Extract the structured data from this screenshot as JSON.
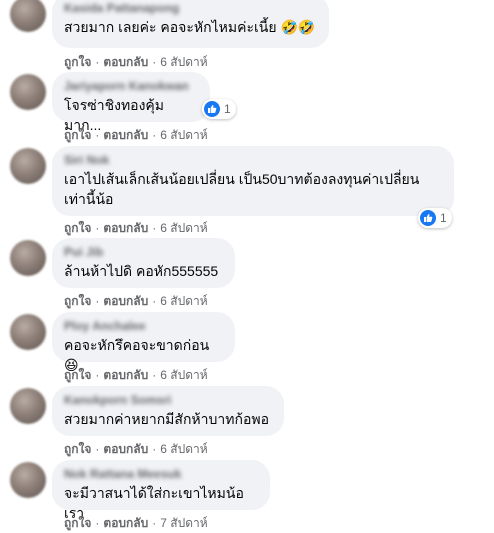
{
  "comments": [
    {
      "author": "Kasida Pattanapong",
      "text": "สวยมาก เลยค่ะ คอจะหักไหมค่ะเนี้ย 🤣🤣",
      "actions": {
        "like": "ถูกใจ",
        "reply": "ตอบกลับ",
        "time": "6 สัปดาห์"
      }
    },
    {
      "author": "Jariyaporn Kanokwan",
      "text": "โจรซ่าชิงทองคุ้มมาก...",
      "reaction_count": "1",
      "actions": {
        "like": "ถูกใจ",
        "reply": "ตอบกลับ",
        "time": "6 สัปดาห์"
      }
    },
    {
      "author": "Siri Nok",
      "text": "เอาไปเส้นเล็กเส้นน้อยเปลี่ยน เป็น50บาทต้องลงทุนค่าเปลี่ยน\nเท่านี้น้อ",
      "reaction_count": "1",
      "actions": {
        "like": "ถูกใจ",
        "reply": "ตอบกลับ",
        "time": "6 สัปดาห์"
      }
    },
    {
      "author": "Pui Jib",
      "text": "ล้านห้าไปดิ คอหัก555555",
      "actions": {
        "like": "ถูกใจ",
        "reply": "ตอบกลับ",
        "time": "6 สัปดาห์"
      }
    },
    {
      "author": "Ploy Anchalee",
      "text": "คอจะหักรึคอจะขาดก่อน😆",
      "actions": {
        "like": "ถูกใจ",
        "reply": "ตอบกลับ",
        "time": "6 สัปดาห์"
      }
    },
    {
      "author": "Kanokporn Somsri",
      "text": "สวยมากค่าหยากมีสักห้าบาทก้อพอ",
      "actions": {
        "like": "ถูกใจ",
        "reply": "ตอบกลับ",
        "time": "6 สัปดาห์"
      }
    },
    {
      "author": "Nok Rattana Meesuk",
      "text": "จะมีวาสนาได้ใส่กะเขาไหมน้อเรา",
      "actions": {
        "like": "ถูกใจ",
        "reply": "ตอบกลับ",
        "time": "7 สัปดาห์"
      }
    }
  ],
  "colors": {
    "bubble": "#f0f2f5",
    "meta": "#65676b",
    "like_blue": "#1877f2"
  },
  "icons": {
    "reaction": "like-thumb-icon"
  }
}
